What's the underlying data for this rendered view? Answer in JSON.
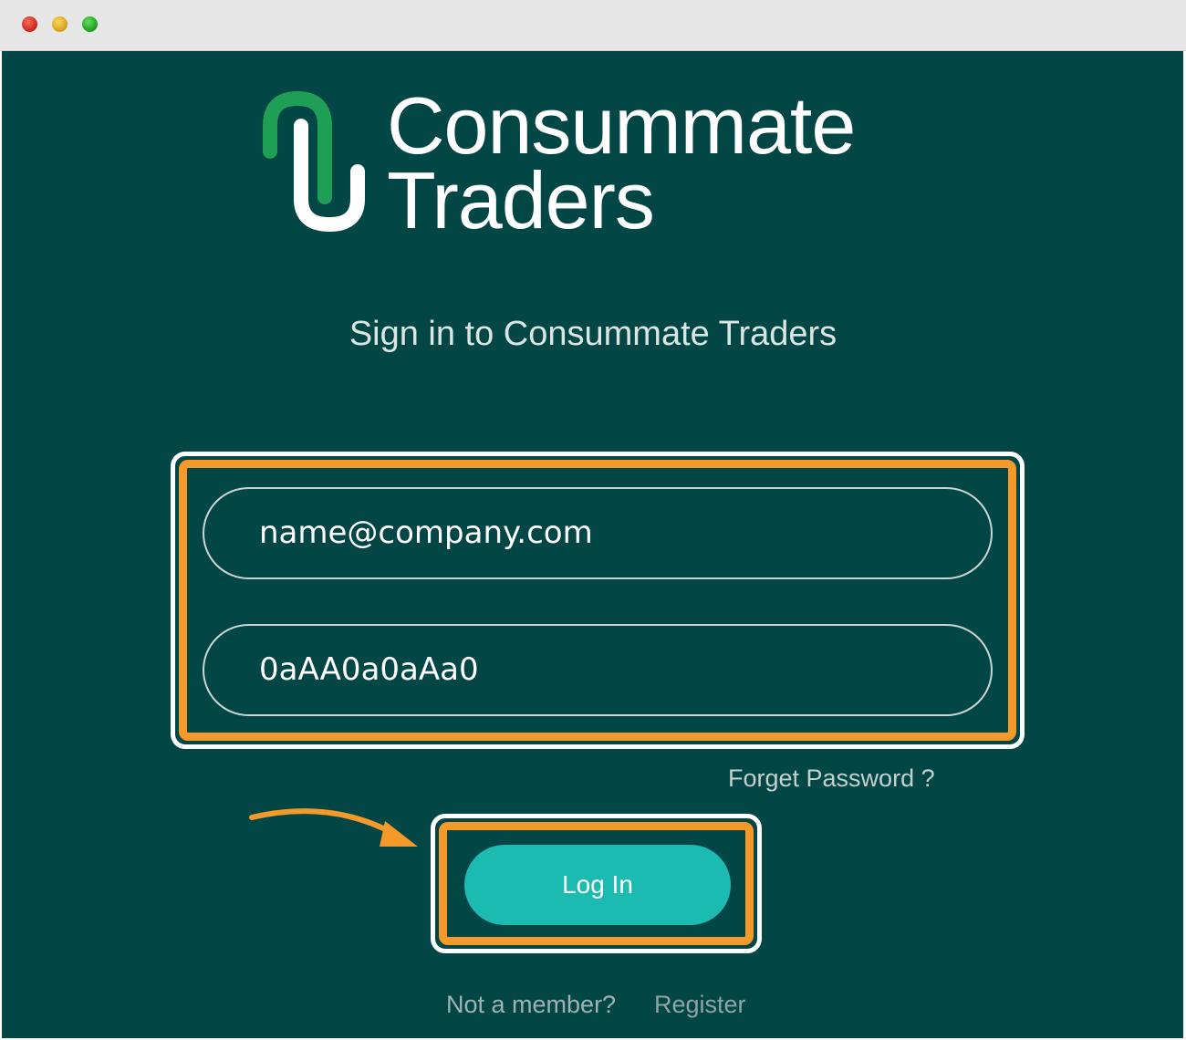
{
  "window": {
    "controls": [
      "close",
      "minimize",
      "zoom"
    ]
  },
  "brand": {
    "line1": "Consummate",
    "line2": "Traders",
    "logo_icon": "paperclip-logo-icon"
  },
  "signin": {
    "title": "Sign in to Consummate Traders"
  },
  "form": {
    "email_value": "name@company.com",
    "password_value": "0aAA0a0aAa0",
    "forgot_label": "Forget Password ?",
    "login_label": "Log In"
  },
  "footer": {
    "not_member": "Not a member?",
    "register": "Register"
  },
  "colors": {
    "background": "#034646",
    "button": "#1bbbb2",
    "highlight": "#f39a2b",
    "logo_accent": "#1f9e55"
  }
}
